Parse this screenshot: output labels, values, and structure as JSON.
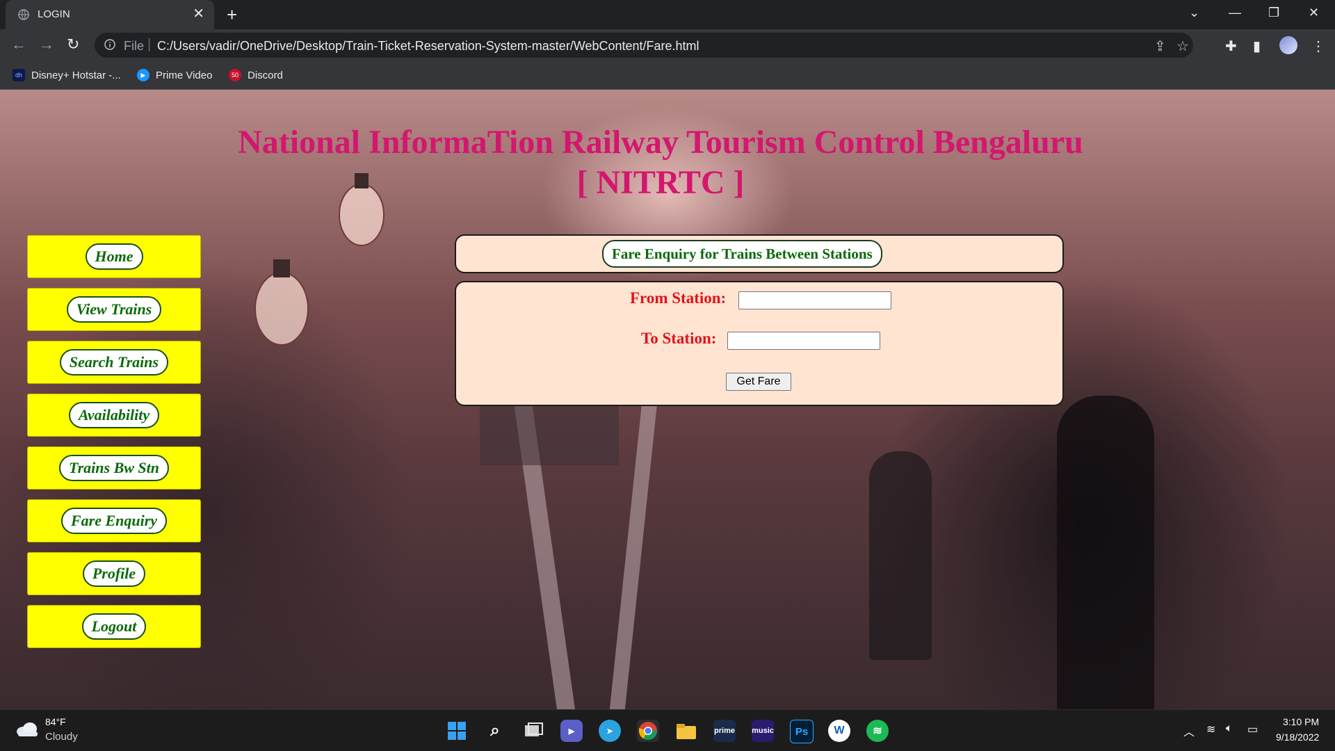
{
  "browser": {
    "tab_title": "LOGIN",
    "url_scheme": "File",
    "url": "C:/Users/vadir/OneDrive/Desktop/Train-Ticket-Reservation-System-master/WebContent/Fare.html",
    "bookmarks": [
      {
        "label": "Disney+ Hotstar -...",
        "icon": "hotstar-icon",
        "color": "#0c1a4b"
      },
      {
        "label": "Prime Video",
        "icon": "prime-video-icon",
        "color": "#1a98ff"
      },
      {
        "label": "Discord",
        "icon": "discord-icon",
        "color": "#c8102e"
      }
    ]
  },
  "page": {
    "title_line1": "National InformaTion Railway Tourism Control Bengaluru",
    "title_line2": "[ NITRTC ]",
    "title_color": "#d3176f",
    "nav": [
      {
        "label": "Home"
      },
      {
        "label": "View Trains"
      },
      {
        "label": "Search Trains"
      },
      {
        "label": "Availability"
      },
      {
        "label": "Trains Bw Stn"
      },
      {
        "label": "Fare Enquiry"
      },
      {
        "label": "Profile"
      },
      {
        "label": "Logout"
      }
    ],
    "heading": "Fare Enquiry for Trains Between Stations",
    "form": {
      "from_label": "From Station:",
      "from_value": "",
      "to_label": "To Station:",
      "to_value": "",
      "submit_label": "Get Fare"
    }
  },
  "taskbar": {
    "weather_temp": "84°F",
    "weather_condition": "Cloudy",
    "time": "3:10 PM",
    "date": "9/18/2022",
    "apps": [
      "windows-start-icon",
      "search-icon",
      "task-view-icon",
      "teams-chat-icon",
      "telegram-icon",
      "chrome-icon",
      "file-explorer-icon",
      "prime-video-icon",
      "amazon-music-icon",
      "photoshop-icon",
      "word-icon",
      "spotify-icon"
    ]
  }
}
